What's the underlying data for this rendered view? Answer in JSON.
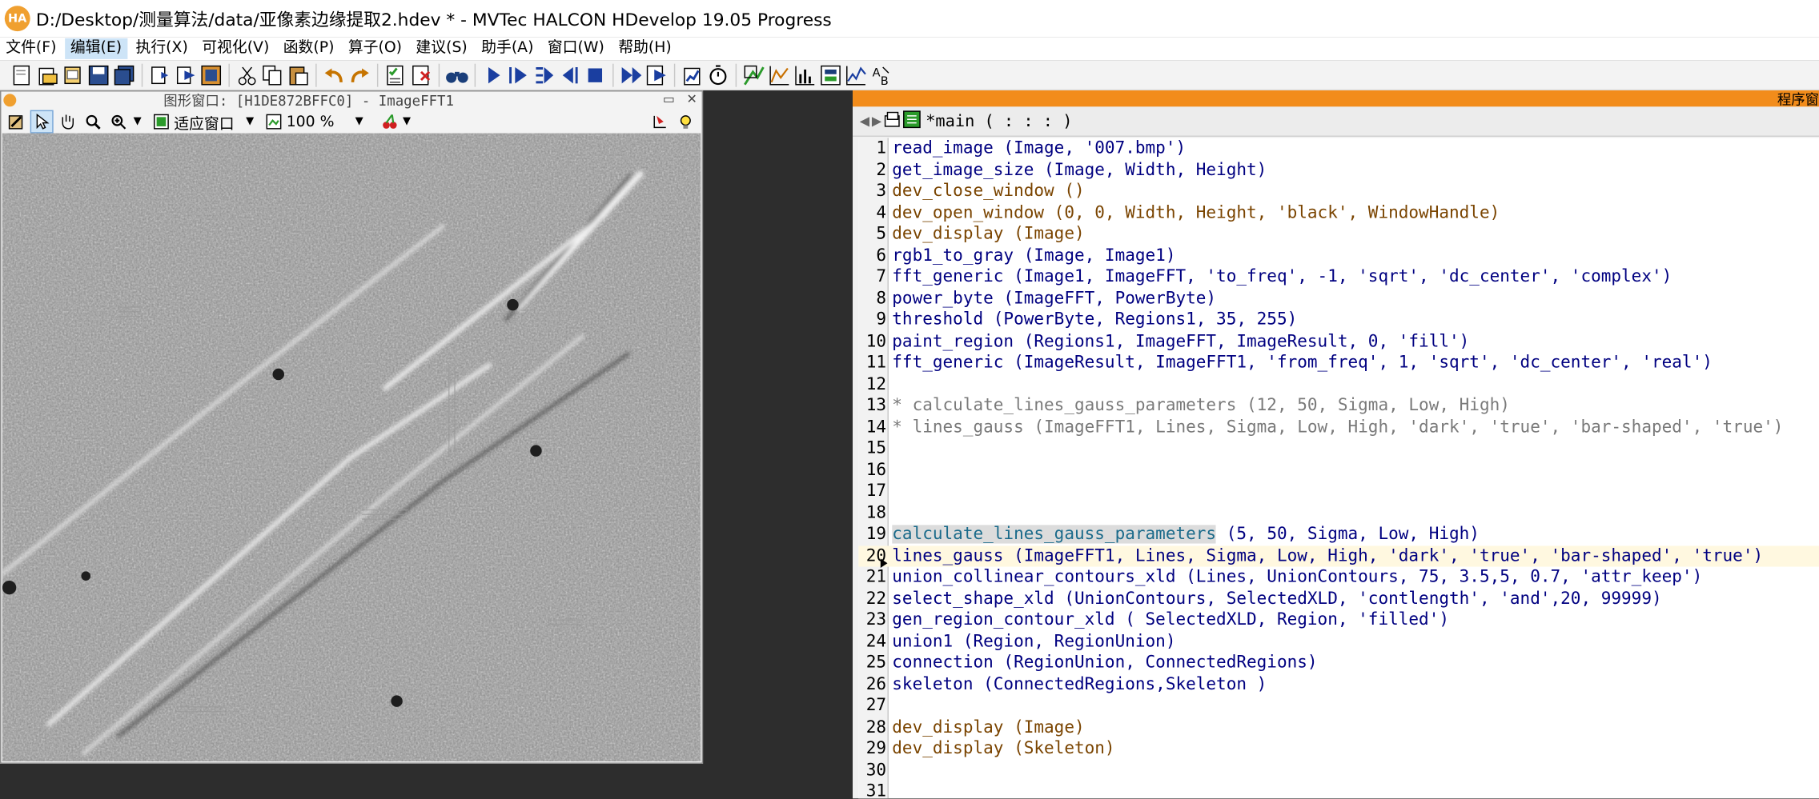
{
  "window": {
    "app_icon": "HA",
    "title": "D:/Desktop/测量算法/data/亚像素边缘提取2.hdev * - MVTec HALCON HDevelop 19.05 Progress"
  },
  "menu": [
    "文件(F)",
    "编辑(E)",
    "执行(X)",
    "可视化(V)",
    "函数(P)",
    "算子(O)",
    "建议(S)",
    "助手(A)",
    "窗口(W)",
    "帮助(H)"
  ],
  "graphics_window": {
    "title": "图形窗口: [H1DE872BFFC0] - ImageFFT1",
    "fit_label": "适应窗口",
    "zoom": "100 %"
  },
  "program_window": {
    "title": "程序窗",
    "procedure": "*main ( : : : )",
    "lines": [
      {
        "n": "1",
        "text": "read_image (Image, '007.bmp')",
        "style": "blue"
      },
      {
        "n": "2",
        "text": "get_image_size (Image, Width, Height)",
        "style": "blue"
      },
      {
        "n": "3",
        "text": "dev_close_window ()",
        "style": "brown"
      },
      {
        "n": "4",
        "text": "dev_open_window (0, 0, Width, Height, 'black', WindowHandle)",
        "style": "brown"
      },
      {
        "n": "5",
        "text": "dev_display (Image)",
        "style": "brown"
      },
      {
        "n": "6",
        "text": "rgb1_to_gray (Image, Image1)",
        "style": "blue"
      },
      {
        "n": "7",
        "text": "fft_generic (Image1, ImageFFT, 'to_freq', -1, 'sqrt', 'dc_center', 'complex')",
        "style": "blue"
      },
      {
        "n": "8",
        "text": "power_byte (ImageFFT, PowerByte)",
        "style": "blue"
      },
      {
        "n": "9",
        "text": "threshold (PowerByte, Regions1, 35, 255)",
        "style": "blue"
      },
      {
        "n": "10",
        "text": "paint_region (Regions1, ImageFFT, ImageResult, 0, 'fill')",
        "style": "blue"
      },
      {
        "n": "11",
        "text": "fft_generic (ImageResult, ImageFFT1, 'from_freq', 1, 'sqrt', 'dc_center', 'real')",
        "style": "blue"
      },
      {
        "n": "12",
        "text": "",
        "style": "blue"
      },
      {
        "n": "13",
        "text": "* calculate_lines_gauss_parameters (12, 50, Sigma, Low, High)",
        "style": "comment"
      },
      {
        "n": "14",
        "text": "* lines_gauss (ImageFFT1, Lines, Sigma, Low, High, 'dark', 'true', 'bar-shaped', 'true')",
        "style": "comment"
      },
      {
        "n": "15",
        "text": "",
        "style": "blue"
      },
      {
        "n": "16",
        "text": "",
        "style": "blue"
      },
      {
        "n": "17",
        "text": "",
        "style": "blue"
      },
      {
        "n": "18",
        "text": "",
        "style": "blue"
      },
      {
        "n": "19",
        "text": "calculate_lines_gauss_parameters (5, 50, Sigma, Low, High)",
        "style": "blue"
      },
      {
        "n": "20",
        "text": "lines_gauss (ImageFFT1, Lines, Sigma, Low, High, 'dark', 'true', 'bar-shaped', 'true')",
        "style": "blue"
      },
      {
        "n": "21",
        "text": "union_collinear_contours_xld (Lines, UnionContours, 75, 3.5,5, 0.7, 'attr_keep')",
        "style": "blue"
      },
      {
        "n": "22",
        "text": "select_shape_xld (UnionContours, SelectedXLD, 'contlength', 'and',20, 99999)",
        "style": "blue"
      },
      {
        "n": "23",
        "text": "gen_region_contour_xld ( SelectedXLD, Region, 'filled')",
        "style": "blue"
      },
      {
        "n": "24",
        "text": "union1 (Region, RegionUnion)",
        "style": "blue"
      },
      {
        "n": "25",
        "text": "connection (RegionUnion, ConnectedRegions)",
        "style": "blue"
      },
      {
        "n": "26",
        "text": "skeleton (ConnectedRegions,Skeleton )",
        "style": "blue"
      },
      {
        "n": "27",
        "text": "",
        "style": "blue"
      },
      {
        "n": "28",
        "text": "dev_display (Image)",
        "style": "brown"
      },
      {
        "n": "29",
        "text": "dev_display (Skeleton)",
        "style": "brown"
      },
      {
        "n": "30",
        "text": "",
        "style": "blue"
      },
      {
        "n": "31",
        "text": "",
        "style": "blue"
      }
    ]
  }
}
